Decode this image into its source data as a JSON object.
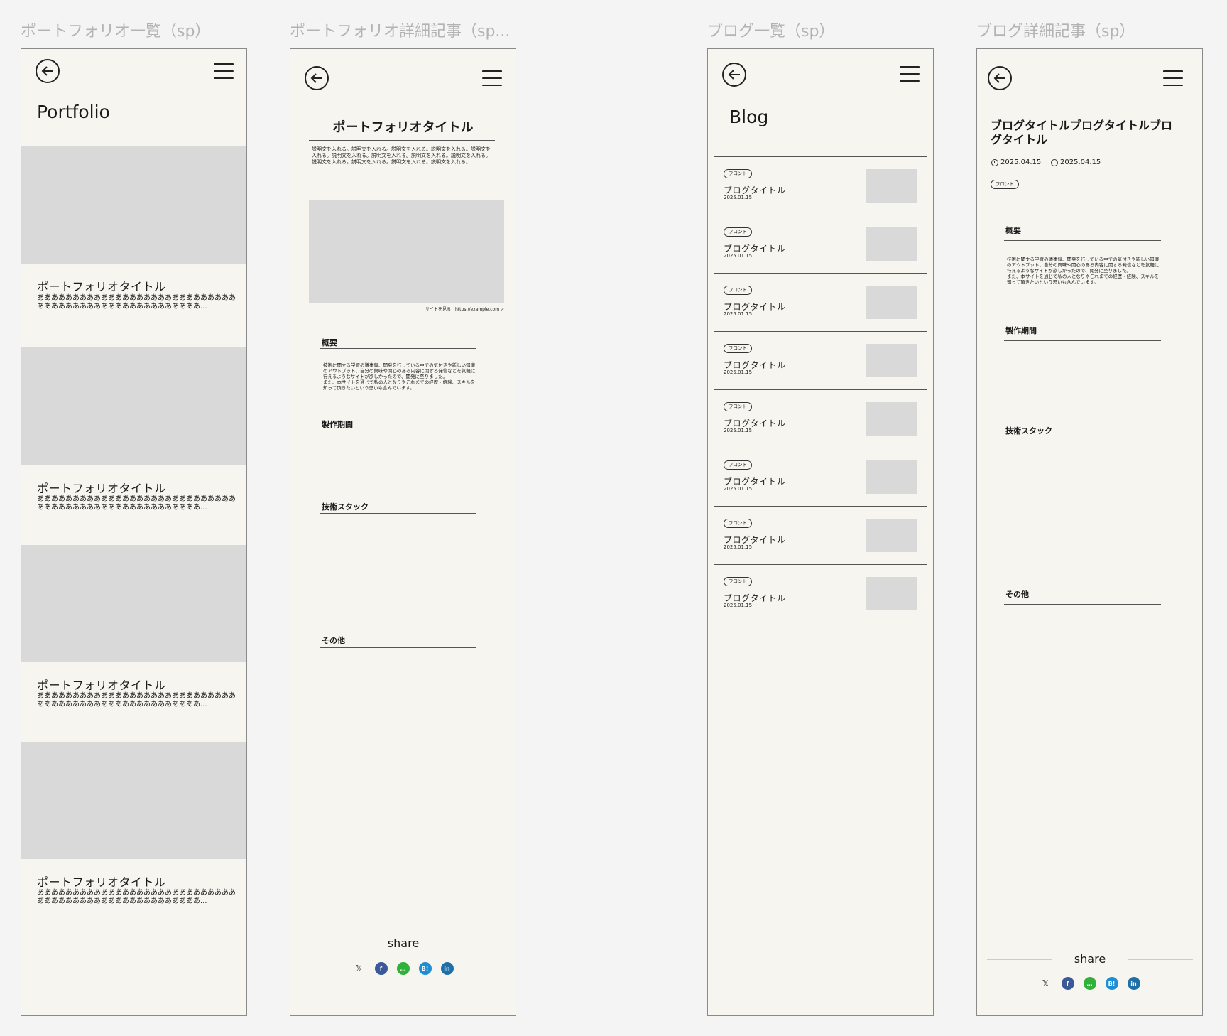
{
  "frames": {
    "portfolio_list": {
      "label": "ポートフォリオ一覧（sp）",
      "heading": "Portfolio",
      "items": [
        {
          "title": "ポートフォリオタイトル",
          "desc": "あああああああああああああああああああああああああああああああああああああああああああああああああああ..."
        },
        {
          "title": "ポートフォリオタイトル",
          "desc": "あああああああああああああああああああああああああああああああああああああああああああああああああああ..."
        },
        {
          "title": "ポートフォリオタイトル",
          "desc": "あああああああああああああああああああああああああああああああああああああああああああああああああああ..."
        },
        {
          "title": "ポートフォリオタイトル",
          "desc": "あああああああああああああああああああああああああああああああああああああああああああああああああああ..."
        }
      ]
    },
    "portfolio_detail": {
      "label": "ポートフォリオ詳細記事（sp...",
      "title": "ポートフォリオタイトル",
      "desc": "説明文を入れる。説明文を入れる。説明文を入れる。説明文を入れる。説明文を入れる。説明文を入れる。説明文を入れる。説明文を入れる。説明文を入れる。説明文を入れる。説明文を入れる。説明文を入れる。説明文を入れる。",
      "site_link": "サイトを見る：https://example.com ↗",
      "sections": {
        "overview": "概要",
        "overview_text": "技術に関する学習の議事録、開発を行っている中での気付きや新しい知識のアウトプット、自分の興味や関心のある内容に関する発信などを気軽に行えるようなサイトが欲しかったので、開発に至りました。\nまた、本サイトを通じて私の人となりやこれまでの経歴・経験、スキルを知って頂きたいという思いも含んでいます。",
        "period": "製作期間",
        "stack": "技術スタック",
        "other": "その他"
      },
      "share": "share"
    },
    "blog_list": {
      "label": "ブログ一覧（sp）",
      "heading": "Blog",
      "items": [
        {
          "tag": "フロント",
          "title": "ブログタイトル",
          "date": "2025.01.15"
        },
        {
          "tag": "フロント",
          "title": "ブログタイトル",
          "date": "2025.01.15"
        },
        {
          "tag": "フロント",
          "title": "ブログタイトル",
          "date": "2025.01.15"
        },
        {
          "tag": "フロント",
          "title": "ブログタイトル",
          "date": "2025.01.15"
        },
        {
          "tag": "フロント",
          "title": "ブログタイトル",
          "date": "2025.01.15"
        },
        {
          "tag": "フロント",
          "title": "ブログタイトル",
          "date": "2025.01.15"
        },
        {
          "tag": "フロント",
          "title": "ブログタイトル",
          "date": "2025.01.15"
        },
        {
          "tag": "フロント",
          "title": "ブログタイトル",
          "date": "2025.01.15"
        }
      ]
    },
    "blog_detail": {
      "label": "ブログ詳細記事（sp）",
      "title": "ブログタイトルブログタイトルブログタイトル",
      "published": "2025.04.15",
      "updated": "2025.04.15",
      "tag": "フロント",
      "sections": {
        "overview": "概要",
        "overview_text": "技術に関する学習の議事録、開発を行っている中での気付きや新しい知識のアウトプット、自分の興味や関心のある内容に関する発信などを気軽に行えるようなサイトが欲しかったので、開発に至りました。\nまた、本サイトを通じて私の人となりやこれまでの経歴・経験、スキルを知って頂きたいという思いも含んでいます。",
        "period": "製作期間",
        "stack": "技術スタック",
        "other": "その他"
      },
      "share": "share"
    }
  },
  "share_icons": [
    {
      "name": "x-icon",
      "glyph": "𝕏",
      "color": "transparent"
    },
    {
      "name": "facebook-icon",
      "glyph": "f",
      "color": "#3b5998"
    },
    {
      "name": "line-icon",
      "glyph": "…",
      "color": "#2fb13a"
    },
    {
      "name": "hatena-icon",
      "glyph": "B!",
      "color": "#1b8fd6"
    },
    {
      "name": "linkedin-icon",
      "glyph": "in",
      "color": "#1d6fa8"
    }
  ],
  "colors": {
    "frame_bg": "#f7f5ef",
    "placeholder": "#d9d9d9",
    "label": "#b3b3b3"
  }
}
